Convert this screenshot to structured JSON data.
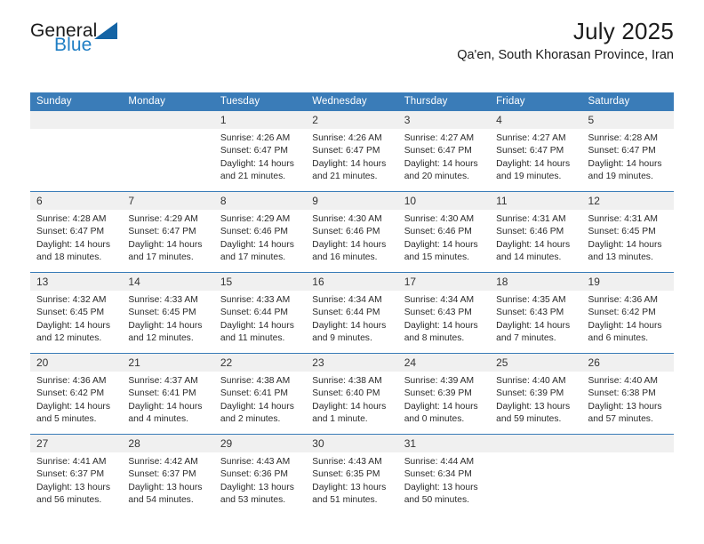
{
  "brand": {
    "name_part1": "General",
    "name_part2": "Blue",
    "triangle_color": "#1464a5",
    "blue_color": "#1f7ec4"
  },
  "header": {
    "title": "July 2025",
    "subtitle": "Qa'en, South Khorasan Province, Iran"
  },
  "calendar": {
    "header_bg": "#3a7cb8",
    "daynum_bg": "#f0f0f0",
    "weekdays": [
      "Sunday",
      "Monday",
      "Tuesday",
      "Wednesday",
      "Thursday",
      "Friday",
      "Saturday"
    ],
    "weeks": [
      [
        {
          "day": "",
          "sunrise": "",
          "sunset": "",
          "daylight": "",
          "empty": true
        },
        {
          "day": "",
          "sunrise": "",
          "sunset": "",
          "daylight": "",
          "empty": true
        },
        {
          "day": "1",
          "sunrise": "Sunrise: 4:26 AM",
          "sunset": "Sunset: 6:47 PM",
          "daylight": "Daylight: 14 hours and 21 minutes."
        },
        {
          "day": "2",
          "sunrise": "Sunrise: 4:26 AM",
          "sunset": "Sunset: 6:47 PM",
          "daylight": "Daylight: 14 hours and 21 minutes."
        },
        {
          "day": "3",
          "sunrise": "Sunrise: 4:27 AM",
          "sunset": "Sunset: 6:47 PM",
          "daylight": "Daylight: 14 hours and 20 minutes."
        },
        {
          "day": "4",
          "sunrise": "Sunrise: 4:27 AM",
          "sunset": "Sunset: 6:47 PM",
          "daylight": "Daylight: 14 hours and 19 minutes."
        },
        {
          "day": "5",
          "sunrise": "Sunrise: 4:28 AM",
          "sunset": "Sunset: 6:47 PM",
          "daylight": "Daylight: 14 hours and 19 minutes."
        }
      ],
      [
        {
          "day": "6",
          "sunrise": "Sunrise: 4:28 AM",
          "sunset": "Sunset: 6:47 PM",
          "daylight": "Daylight: 14 hours and 18 minutes."
        },
        {
          "day": "7",
          "sunrise": "Sunrise: 4:29 AM",
          "sunset": "Sunset: 6:47 PM",
          "daylight": "Daylight: 14 hours and 17 minutes."
        },
        {
          "day": "8",
          "sunrise": "Sunrise: 4:29 AM",
          "sunset": "Sunset: 6:46 PM",
          "daylight": "Daylight: 14 hours and 17 minutes."
        },
        {
          "day": "9",
          "sunrise": "Sunrise: 4:30 AM",
          "sunset": "Sunset: 6:46 PM",
          "daylight": "Daylight: 14 hours and 16 minutes."
        },
        {
          "day": "10",
          "sunrise": "Sunrise: 4:30 AM",
          "sunset": "Sunset: 6:46 PM",
          "daylight": "Daylight: 14 hours and 15 minutes."
        },
        {
          "day": "11",
          "sunrise": "Sunrise: 4:31 AM",
          "sunset": "Sunset: 6:46 PM",
          "daylight": "Daylight: 14 hours and 14 minutes."
        },
        {
          "day": "12",
          "sunrise": "Sunrise: 4:31 AM",
          "sunset": "Sunset: 6:45 PM",
          "daylight": "Daylight: 14 hours and 13 minutes."
        }
      ],
      [
        {
          "day": "13",
          "sunrise": "Sunrise: 4:32 AM",
          "sunset": "Sunset: 6:45 PM",
          "daylight": "Daylight: 14 hours and 12 minutes."
        },
        {
          "day": "14",
          "sunrise": "Sunrise: 4:33 AM",
          "sunset": "Sunset: 6:45 PM",
          "daylight": "Daylight: 14 hours and 12 minutes."
        },
        {
          "day": "15",
          "sunrise": "Sunrise: 4:33 AM",
          "sunset": "Sunset: 6:44 PM",
          "daylight": "Daylight: 14 hours and 11 minutes."
        },
        {
          "day": "16",
          "sunrise": "Sunrise: 4:34 AM",
          "sunset": "Sunset: 6:44 PM",
          "daylight": "Daylight: 14 hours and 9 minutes."
        },
        {
          "day": "17",
          "sunrise": "Sunrise: 4:34 AM",
          "sunset": "Sunset: 6:43 PM",
          "daylight": "Daylight: 14 hours and 8 minutes."
        },
        {
          "day": "18",
          "sunrise": "Sunrise: 4:35 AM",
          "sunset": "Sunset: 6:43 PM",
          "daylight": "Daylight: 14 hours and 7 minutes."
        },
        {
          "day": "19",
          "sunrise": "Sunrise: 4:36 AM",
          "sunset": "Sunset: 6:42 PM",
          "daylight": "Daylight: 14 hours and 6 minutes."
        }
      ],
      [
        {
          "day": "20",
          "sunrise": "Sunrise: 4:36 AM",
          "sunset": "Sunset: 6:42 PM",
          "daylight": "Daylight: 14 hours and 5 minutes."
        },
        {
          "day": "21",
          "sunrise": "Sunrise: 4:37 AM",
          "sunset": "Sunset: 6:41 PM",
          "daylight": "Daylight: 14 hours and 4 minutes."
        },
        {
          "day": "22",
          "sunrise": "Sunrise: 4:38 AM",
          "sunset": "Sunset: 6:41 PM",
          "daylight": "Daylight: 14 hours and 2 minutes."
        },
        {
          "day": "23",
          "sunrise": "Sunrise: 4:38 AM",
          "sunset": "Sunset: 6:40 PM",
          "daylight": "Daylight: 14 hours and 1 minute."
        },
        {
          "day": "24",
          "sunrise": "Sunrise: 4:39 AM",
          "sunset": "Sunset: 6:39 PM",
          "daylight": "Daylight: 14 hours and 0 minutes."
        },
        {
          "day": "25",
          "sunrise": "Sunrise: 4:40 AM",
          "sunset": "Sunset: 6:39 PM",
          "daylight": "Daylight: 13 hours and 59 minutes."
        },
        {
          "day": "26",
          "sunrise": "Sunrise: 4:40 AM",
          "sunset": "Sunset: 6:38 PM",
          "daylight": "Daylight: 13 hours and 57 minutes."
        }
      ],
      [
        {
          "day": "27",
          "sunrise": "Sunrise: 4:41 AM",
          "sunset": "Sunset: 6:37 PM",
          "daylight": "Daylight: 13 hours and 56 minutes."
        },
        {
          "day": "28",
          "sunrise": "Sunrise: 4:42 AM",
          "sunset": "Sunset: 6:37 PM",
          "daylight": "Daylight: 13 hours and 54 minutes."
        },
        {
          "day": "29",
          "sunrise": "Sunrise: 4:43 AM",
          "sunset": "Sunset: 6:36 PM",
          "daylight": "Daylight: 13 hours and 53 minutes."
        },
        {
          "day": "30",
          "sunrise": "Sunrise: 4:43 AM",
          "sunset": "Sunset: 6:35 PM",
          "daylight": "Daylight: 13 hours and 51 minutes."
        },
        {
          "day": "31",
          "sunrise": "Sunrise: 4:44 AM",
          "sunset": "Sunset: 6:34 PM",
          "daylight": "Daylight: 13 hours and 50 minutes."
        },
        {
          "day": "",
          "sunrise": "",
          "sunset": "",
          "daylight": "",
          "empty": true
        },
        {
          "day": "",
          "sunrise": "",
          "sunset": "",
          "daylight": "",
          "empty": true
        }
      ]
    ]
  }
}
